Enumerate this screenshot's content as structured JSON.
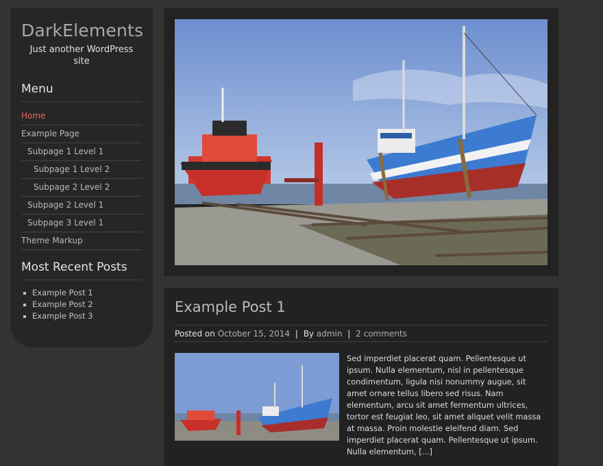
{
  "site": {
    "title": "DarkElements",
    "tagline": "Just another WordPress site"
  },
  "sidebar": {
    "menu_title": "Menu",
    "menu_items": [
      {
        "label": "Home",
        "level": 0,
        "active": true
      },
      {
        "label": "Example Page",
        "level": 0
      },
      {
        "label": "Subpage 1 Level 1",
        "level": 1
      },
      {
        "label": "Subpage 1 Level 2",
        "level": 2
      },
      {
        "label": "Subpage 2 Level 2",
        "level": 2
      },
      {
        "label": "Subpage 2 Level 1",
        "level": 1
      },
      {
        "label": "Subpage 3 Level 1",
        "level": 1
      },
      {
        "label": "Theme Markup",
        "level": 0
      }
    ],
    "recent_title": "Most Recent Posts",
    "recent_posts": [
      "Example Post 1",
      "Example Post 2",
      "Example Post 3"
    ]
  },
  "post": {
    "title": "Example Post 1",
    "posted_on_label": "Posted on",
    "date": "October 15, 2014",
    "by_label": "By",
    "author": "admin",
    "comments": "2 comments",
    "excerpt": "Sed imperdiet placerat quam. Pellentesque ut ipsum. Nulla elementum, nisl in pellentesque condimentum, ligula nisi nonummy augue, sit amet ornare tellus libero sed risus. Nam elementum, arcu sit amet fermentum ultrices, tortor est feugiat leo, sit amet aliquet velit massa at massa. Proin molestie eleifend diam. Sed imperdiet placerat quam. Pellentesque ut ipsum. Nulla elementum,",
    "more": "[...]"
  },
  "colors": {
    "background": "#333333",
    "panel": "#222222",
    "sidebar": "#262626",
    "active_link": "#e06a5e"
  }
}
